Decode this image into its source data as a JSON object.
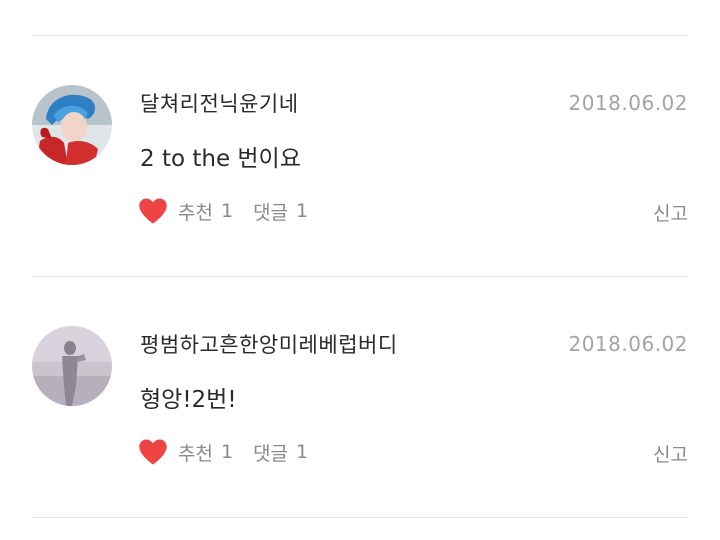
{
  "comments": [
    {
      "username": "달쳐리전닉윤기네",
      "date": "2018.06.02",
      "text": "2 to the 번이요",
      "like_label": "추천",
      "like_count": "1",
      "reply_label": "댓글",
      "reply_count": "1",
      "report_label": "신고",
      "avatar_icon": "user-photo-blue-hair"
    },
    {
      "username": "평범하고흔한앙미레베럽버디",
      "date": "2018.06.02",
      "text": "형앙!2번!",
      "like_label": "추천",
      "like_count": "1",
      "reply_label": "댓글",
      "reply_count": "1",
      "report_label": "신고",
      "avatar_icon": "user-photo-silhouette"
    }
  ],
  "colors": {
    "heart": "#ef4444",
    "divider": "#e3e3e3",
    "muted_text": "#8a8a8a",
    "date_text": "#a4a4a4"
  }
}
